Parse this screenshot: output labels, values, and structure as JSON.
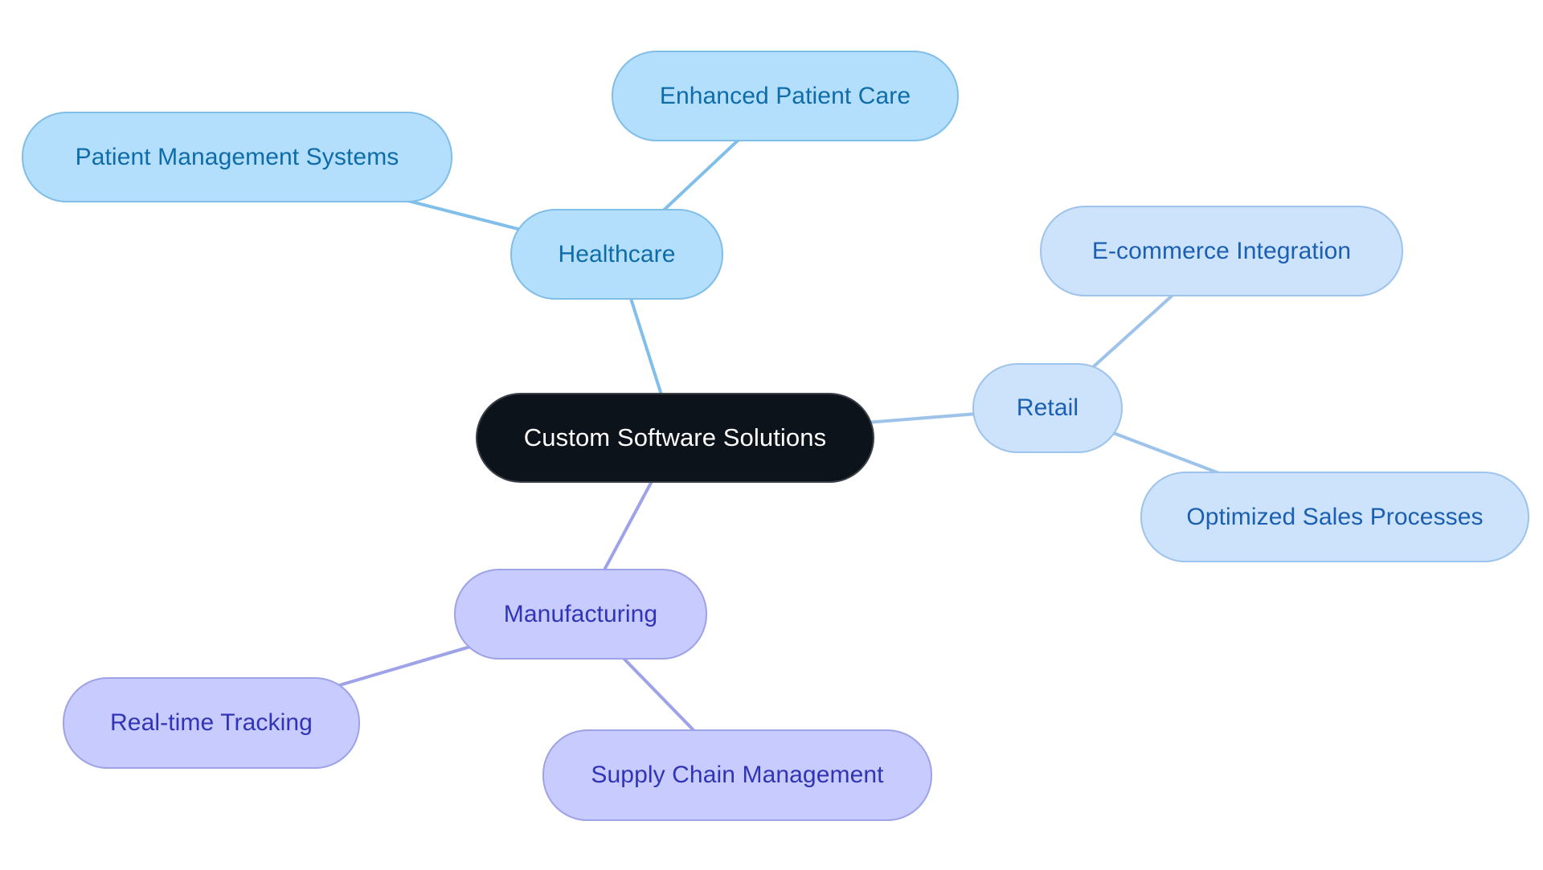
{
  "diagram": {
    "type": "mind-map",
    "root": {
      "id": "root",
      "label": "Custom Software Solutions"
    },
    "branches": [
      {
        "id": "healthcare",
        "label": "Healthcare",
        "color": {
          "fill": "#B3DFFD",
          "stroke": "#80BEE8",
          "text": "#0E6CA8",
          "edge": "#80BFE9"
        },
        "children": [
          {
            "id": "enhanced-patient-care",
            "label": "Enhanced Patient Care"
          },
          {
            "id": "patient-management-systems",
            "label": "Patient Management Systems"
          }
        ]
      },
      {
        "id": "retail",
        "label": "Retail",
        "color": {
          "fill": "#CCE3FB",
          "stroke": "#9EC3EC",
          "text": "#1B5FB3",
          "edge": "#9EC3EB"
        },
        "children": [
          {
            "id": "ecommerce-integration",
            "label": "E-commerce Integration"
          },
          {
            "id": "optimized-sales-processes",
            "label": "Optimized Sales Processes"
          }
        ]
      },
      {
        "id": "manufacturing",
        "label": "Manufacturing",
        "color": {
          "fill": "#C7CBFD",
          "stroke": "#9EA2E6",
          "text": "#3135B5",
          "edge": "#9EA2E8"
        },
        "children": [
          {
            "id": "real-time-tracking",
            "label": "Real-time Tracking"
          },
          {
            "id": "supply-chain-management",
            "label": "Supply Chain Management"
          }
        ]
      }
    ],
    "root_color": {
      "fill": "#0D131A",
      "text": "#FFFFFF"
    }
  }
}
